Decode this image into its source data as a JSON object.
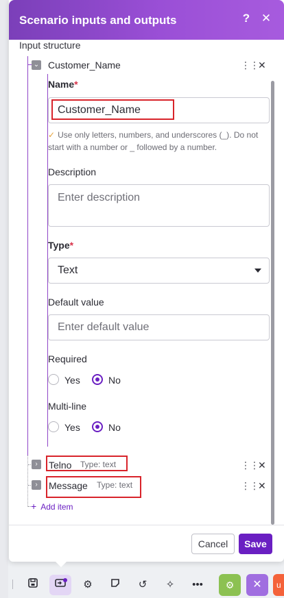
{
  "dialog": {
    "title": "Scenario inputs and outputs",
    "help_label": "?",
    "close_label": "✕",
    "section_title": "Input structure"
  },
  "expanded_item": {
    "name": "Customer_Name",
    "fields": {
      "name_label": "Name",
      "name_required_mark": "*",
      "name_value": "Customer_Name",
      "name_hint": "Use only letters, numbers, and underscores (_). Do not start with a number or _ followed by a number.",
      "description_label": "Description",
      "description_placeholder": "Enter description",
      "type_label": "Type",
      "type_required_mark": "*",
      "type_value": "Text",
      "default_label": "Default value",
      "default_placeholder": "Enter default value",
      "required_label": "Required",
      "required_options": [
        "Yes",
        "No"
      ],
      "required_selected": "No",
      "multiline_label": "Multi-line",
      "multiline_options": [
        "Yes",
        "No"
      ],
      "multiline_selected": "No"
    }
  },
  "collapsed_items": [
    {
      "name": "Telno",
      "type": "Type: text"
    },
    {
      "name": "Message",
      "type": "Type: text"
    }
  ],
  "add_item_label": "Add item",
  "footer": {
    "cancel_label": "Cancel",
    "save_label": "Save"
  },
  "toolbar": {
    "icons": [
      "save-icon",
      "scenario-io-icon",
      "settings-icon",
      "notes-icon",
      "undo-icon",
      "magic-wand-icon",
      "more-icon",
      "run-settings-icon",
      "tools-icon",
      "orange-action-icon"
    ]
  },
  "colors": {
    "header_start": "#7b3fb9",
    "header_end": "#a75bde",
    "accent": "#6a1fc2",
    "required_mark": "#d8344b",
    "highlight_box": "#d8232a"
  }
}
